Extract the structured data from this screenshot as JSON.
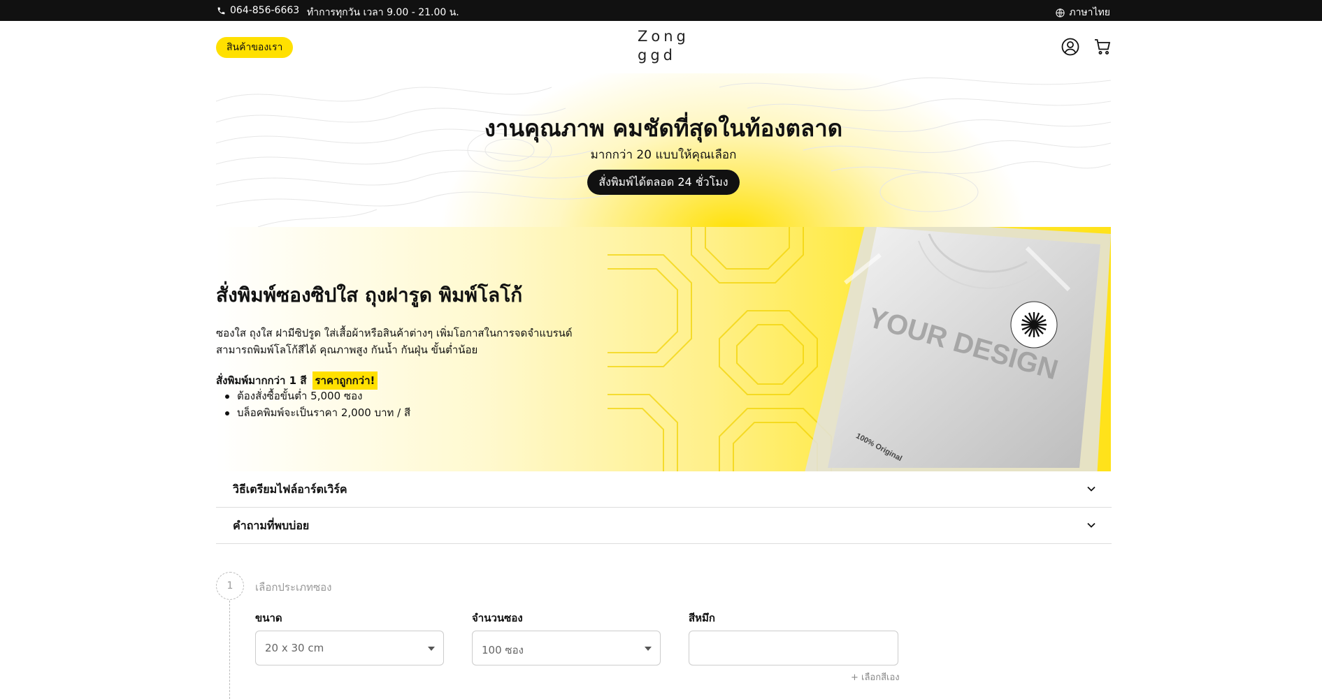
{
  "topbar": {
    "phone": "064-856-6663",
    "hours": "ทำการทุกวัน เวลา 9.00 - 21.00 น.",
    "language": "ภาษาไทย"
  },
  "header": {
    "products_button": "สินค้าของเรา",
    "logo_line1": "Zong",
    "logo_line2": "ggd"
  },
  "hero": {
    "title": "งานคุณภาพ คมชัดที่สุดในท้องตลาด",
    "subtitle": "มากกว่า 20 แบบให้คุณเลือก",
    "cta": "สั่งพิมพ์ได้ตลอด 24 ชั่วโมง"
  },
  "banner": {
    "title": "สั่งพิมพ์ซองซิปใส ถุงฝารูด พิมพ์โลโก้",
    "desc_line1": "ซองใส ถุงใส ฝามีซิปรูด ใส่เสื้อผ้าหรือสินค้าต่างๆ เพิ่มโอกาสในการจดจำแบรนด์",
    "desc_line2": "สามารถพิมพ์โลโก้สีได้ คุณภาพสูง กันน้ำ กันฝุ่น ขั้นต่ำน้อย",
    "promo_text": "สั่งพิมพ์มากกว่า 1 สี",
    "promo_badge": "ราคาถูกกว่า!",
    "bullets": [
      "ต้องสั่งซื้อขั้นต่ำ 5,000 ซอง",
      "บล็อคพิมพ์จะเป็นราคา 2,000 บาท / สี"
    ],
    "image_text": "YOUR DESIGN",
    "image_tag": "100% Original"
  },
  "accordions": [
    {
      "label": "วิธีเตรียมไฟล์อาร์ตเวิร์ค"
    },
    {
      "label": "คำถามที่พบบ่อย"
    }
  ],
  "step": {
    "number": "1",
    "title": "เลือกประเภทซอง",
    "size_label": "ขนาด",
    "size_value": "20 x 30 cm",
    "qty_label": "จำนวนซอง",
    "qty_value": "100 ซอง",
    "ink_label": "สีหมึก",
    "ink_value": "",
    "pick_color": "+ เลือกสีเอง"
  },
  "colors": {
    "accent": "#ffe000",
    "dark": "#111111"
  }
}
